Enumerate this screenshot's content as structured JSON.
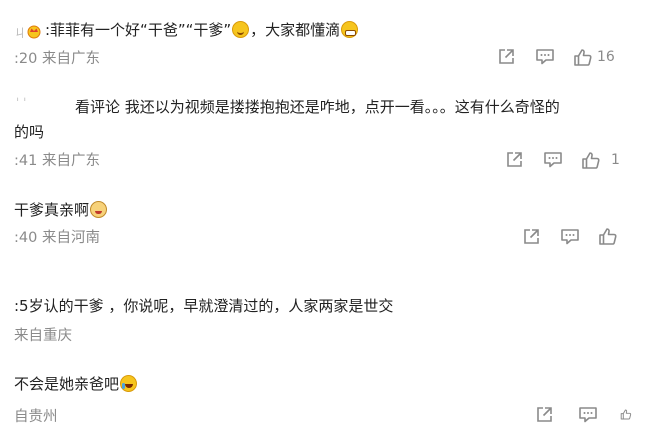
{
  "comments": [
    {
      "text_prefix": ":菲菲有一个好“干爸”“干爹”",
      "text_suffix": "，大家都懂滴",
      "meta": ":20 来自广东",
      "like_count": "16"
    },
    {
      "text_line1": "看评论 我还以为视频是搂搂抱抱还是咋地，点开一看。。。这有什么奇怪的",
      "text_line2": "的吗",
      "meta": ":41 来自广东",
      "like_count": "1"
    },
    {
      "text": "干爹真亲啊",
      "meta": ":40 来自河南"
    },
    {
      "text": ":5岁认的干爹 ，你说呢，早就澄清过的，人家两家是世交",
      "meta": "来自重庆"
    },
    {
      "text": "不会是她亲爸吧",
      "meta": "自贵州"
    }
  ]
}
